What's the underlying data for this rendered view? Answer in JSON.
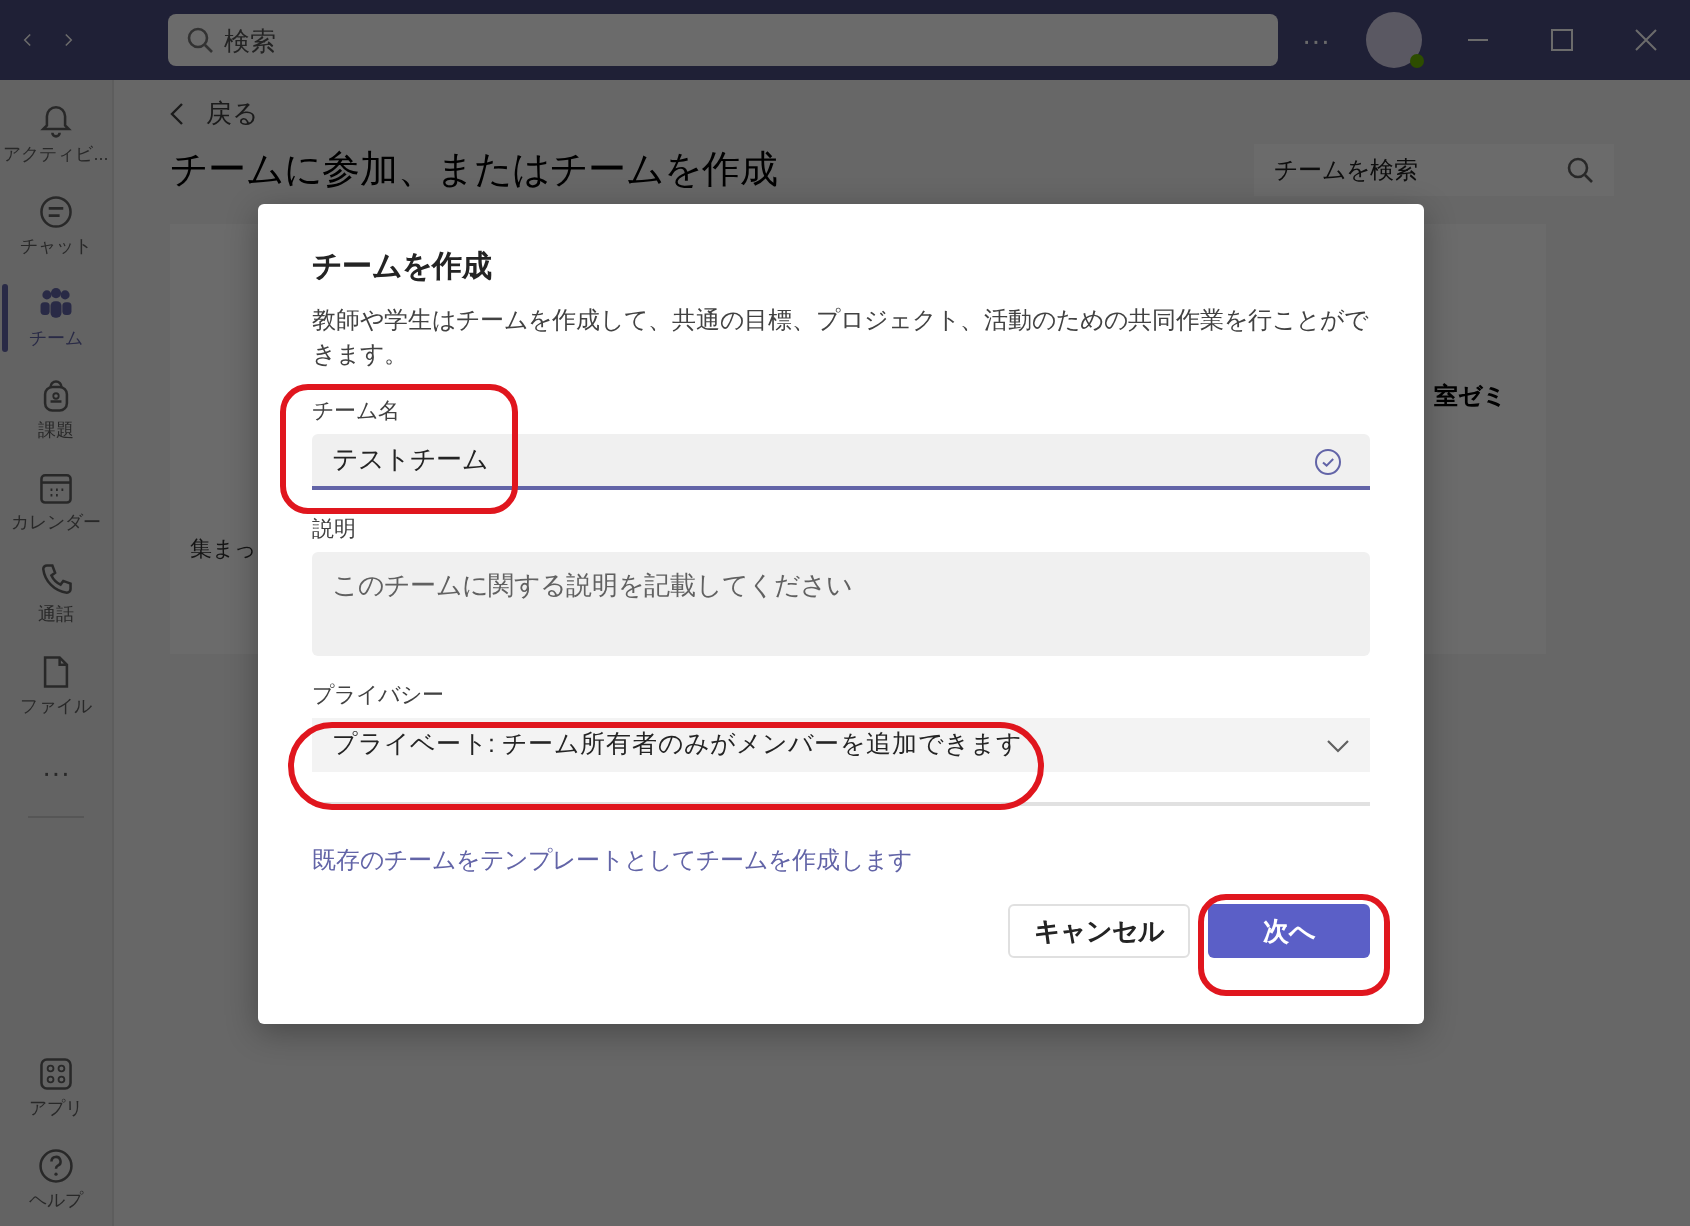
{
  "title_bar": {
    "search": {
      "placeholder": "検索"
    },
    "more": "···"
  },
  "rail": {
    "items": [
      {
        "label": "アクティビ...",
        "selected": false
      },
      {
        "label": "チャット",
        "selected": false
      },
      {
        "label": "チーム",
        "selected": true
      },
      {
        "label": "課題",
        "selected": false
      },
      {
        "label": "カレンダー",
        "selected": false
      },
      {
        "label": "通話",
        "selected": false
      },
      {
        "label": "ファイル",
        "selected": false
      }
    ],
    "more": "···",
    "bottom_items": [
      {
        "label": "アプリ",
        "selected": false
      },
      {
        "label": "ヘルプ",
        "selected": false
      }
    ]
  },
  "main": {
    "back": "戻る",
    "heading": "チームに参加、またはチームを作成",
    "team_search": {
      "placeholder": "チームを検索"
    },
    "cards": [
      {
        "text": "集まっ"
      },
      {
        "text": "室ゼミ"
      }
    ]
  },
  "dialog": {
    "title": "チームを作成",
    "description": "教師や学生はチームを作成して、共通の目標、プロジェクト、活動のための共同作業を行ことができます。",
    "name_field": {
      "label": "チーム名",
      "value": "テストチーム",
      "valid": true
    },
    "description_field": {
      "label": "説明",
      "placeholder": "このチームに関する説明を記載してください"
    },
    "privacy": {
      "label": "プライバシー",
      "value": "プライベート: チーム所有者のみがメンバーを追加できます"
    },
    "template_link": "既存のチームをテンプレートとしてチームを作成します",
    "buttons": [
      {
        "label": "キャンセル",
        "kind": "secondary"
      },
      {
        "label": "次へ",
        "kind": "primary"
      }
    ]
  }
}
